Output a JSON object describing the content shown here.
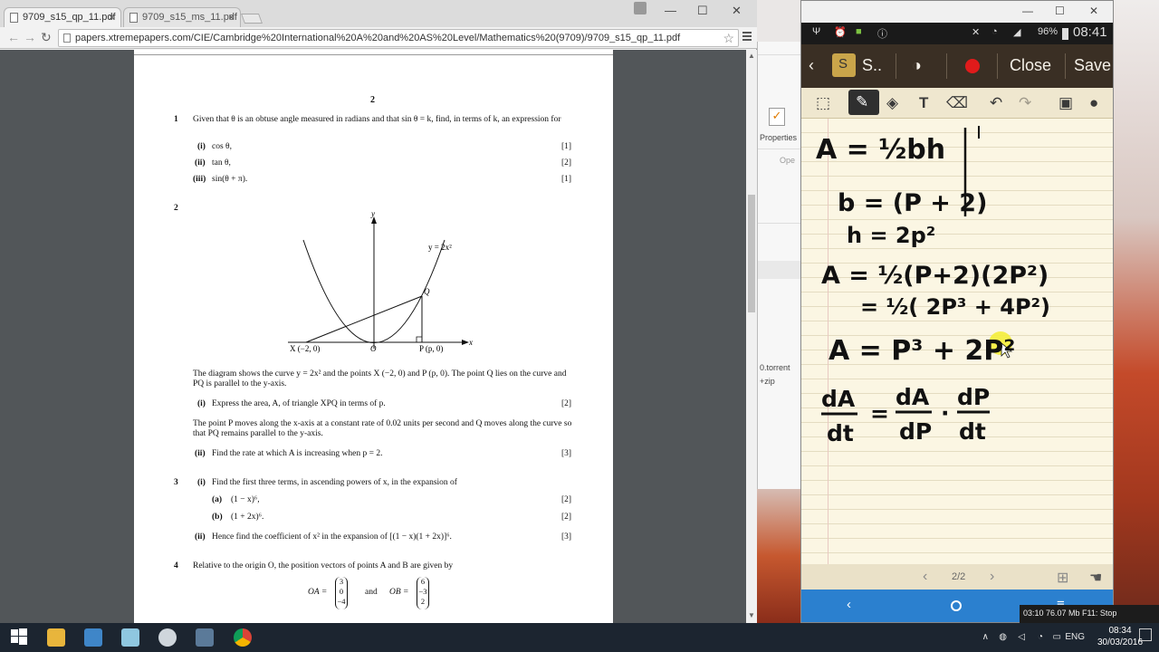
{
  "browser": {
    "tabs": [
      {
        "label": "9709_s15_qp_11.pdf",
        "active": true
      },
      {
        "label": "9709_s15_ms_11.pdf",
        "active": false
      }
    ],
    "url": "papers.xtremepapers.com/CIE/Cambridge%20International%20A%20and%20AS%20Level/Mathematics%20(9709)/9709_s15_qp_11.pdf"
  },
  "pdf": {
    "page_number": "2",
    "q1": {
      "number": "1",
      "text": "Given that θ is an obtuse angle measured in radians and that sin θ = k, find, in terms of k, an expression for",
      "parts": [
        {
          "label": "(i)",
          "text": "cos θ,",
          "marks": "[1]"
        },
        {
          "label": "(ii)",
          "text": "tan θ,",
          "marks": "[2]"
        },
        {
          "label": "(iii)",
          "text": "sin(θ + π).",
          "marks": "[1]"
        }
      ]
    },
    "q2": {
      "number": "2",
      "graph_labels": {
        "y_axis": "y",
        "x_axis": "x",
        "curve": "y = 2x²",
        "q_point": "Q",
        "x_point": "X (−2, 0)",
        "origin": "O",
        "p_point": "P (p, 0)"
      },
      "text1": "The diagram shows the curve y = 2x² and the points X (−2, 0) and P (p, 0). The point Q lies on the curve and PQ is parallel to the y-axis.",
      "part_i": {
        "label": "(i)",
        "text": "Express the area, A, of triangle XPQ in terms of p.",
        "marks": "[2]"
      },
      "text2": "The point P moves along the x-axis at a constant rate of 0.02 units per second and Q moves along the curve so that PQ remains parallel to the y-axis.",
      "part_ii": {
        "label": "(ii)",
        "text": "Find the rate at which A is increasing when p = 2.",
        "marks": "[3]"
      }
    },
    "q3": {
      "number": "3",
      "part_i": {
        "label": "(i)",
        "text": "Find the first three terms, in ascending powers of x, in the expansion of"
      },
      "sub_a": {
        "label": "(a)",
        "text": "(1 − x)⁶,",
        "marks": "[2]"
      },
      "sub_b": {
        "label": "(b)",
        "text": "(1 + 2x)⁶.",
        "marks": "[2]"
      },
      "part_ii": {
        "label": "(ii)",
        "text": "Hence find the coefficient of x² in the expansion of [(1 − x)(1 + 2x)]⁶.",
        "marks": "[3]"
      }
    },
    "q4": {
      "number": "4",
      "text": "Relative to the origin O, the position vectors of points A and B are given by",
      "oa_label": "OA =",
      "oa": [
        "3",
        "0",
        "−4"
      ],
      "and": "and",
      "ob_label": "OB =",
      "ob": [
        "6",
        "−3",
        "2"
      ]
    }
  },
  "bg_window": {
    "properties": "Properties",
    "open": "Ope",
    "file1": "0.torrent",
    "file2": "+zip"
  },
  "phone": {
    "status": {
      "battery": "96%",
      "time": "08:41"
    },
    "actionbar": {
      "app_short": "S..",
      "close": "Close",
      "save": "Save"
    },
    "page_indicator": "2/2",
    "notes": {
      "l1": "A = ½bh",
      "l2": "b = (P + 2)",
      "l3": "h = 2p²",
      "l4": "A = ½(P+2)(2P²)",
      "l5": "= ½( 2P³ + 4P²)",
      "l6": "A = P³ + 2P²",
      "frac1_top": "dA",
      "frac1_bot": "dt",
      "eq": "=",
      "frac2_top": "dA",
      "frac2_bot": "dP",
      "dot": "·",
      "frac3_top": "dP",
      "frac3_bot": "dt"
    },
    "colors": {
      "ink": "#111111",
      "highlighter": "#f4ee3a",
      "navbar": "#2b80cf",
      "actionbar": "#3a2f24"
    }
  },
  "recorder": {
    "text": "03:10  76.07 Mb  F11: Stop"
  },
  "taskbar": {
    "lang": "ENG",
    "time": "08:34",
    "date": "30/03/2016"
  }
}
